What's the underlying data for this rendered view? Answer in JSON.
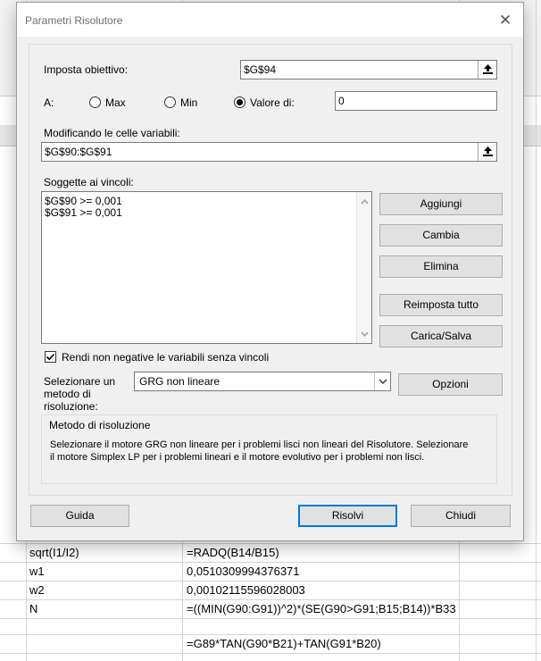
{
  "dialog": {
    "title": "Parametri Risolutore",
    "set_objective_label": "Imposta obiettivo:",
    "set_objective_value": "$G$94",
    "to_label": "A:",
    "radio_max_label": "Max",
    "radio_min_label": "Min",
    "radio_value_of_label": "Valore di:",
    "selected_target": "Valore di:",
    "value_of": "0",
    "changing_cells_label": "Modificando le celle variabili:",
    "changing_cells_value": "$G$90:$G$91",
    "constraints_label": "Soggette ai vincoli:",
    "constraints": [
      "$G$90 >= 0,001",
      "$G$91 >= 0,001"
    ],
    "buttons": {
      "add": "Aggiungi",
      "change": "Cambia",
      "delete": "Elimina",
      "reset_all": "Reimposta tutto",
      "load_save": "Carica/Salva",
      "options": "Opzioni",
      "help": "Guida",
      "solve": "Risolvi",
      "close": "Chiudi"
    },
    "nonneg_checkbox_label": "Rendi non negative le variabili senza vincoli",
    "nonneg_checked": true,
    "select_method_label_1": "Selezionare un",
    "select_method_label_2": "metodo di",
    "select_method_label_3": "risoluzione:",
    "method_value": "GRG non lineare",
    "method_group_title": "Metodo di risoluzione",
    "method_desc_line1": "Selezionare il motore GRG non lineare per i problemi lisci non lineari del Risolutore. Selezionare",
    "method_desc_line2": "il motore Simplex LP per i problemi lineari e il motore evolutivo per i problemi non lisci."
  },
  "sheet": {
    "rows": [
      {
        "a": "sqrt(I1/I2)",
        "b": "=RADQ(B14/B15)"
      },
      {
        "a": "w1",
        "b": "0,0510309994376371"
      },
      {
        "a": "w2",
        "b": "0,00102115596028003"
      },
      {
        "a": "N",
        "b": "=((MIN(G90:G91))^2)*(SE(G90>G91;B15;B14))*B33"
      },
      {
        "a": "",
        "b": ""
      },
      {
        "a": "",
        "b": "=G89*TAN(G90*B21)+TAN(G91*B20)"
      }
    ]
  },
  "colors": {
    "accent": "#0078d7",
    "dialog_bg": "#f0f0f0",
    "button_bg": "#e1e1e1"
  }
}
